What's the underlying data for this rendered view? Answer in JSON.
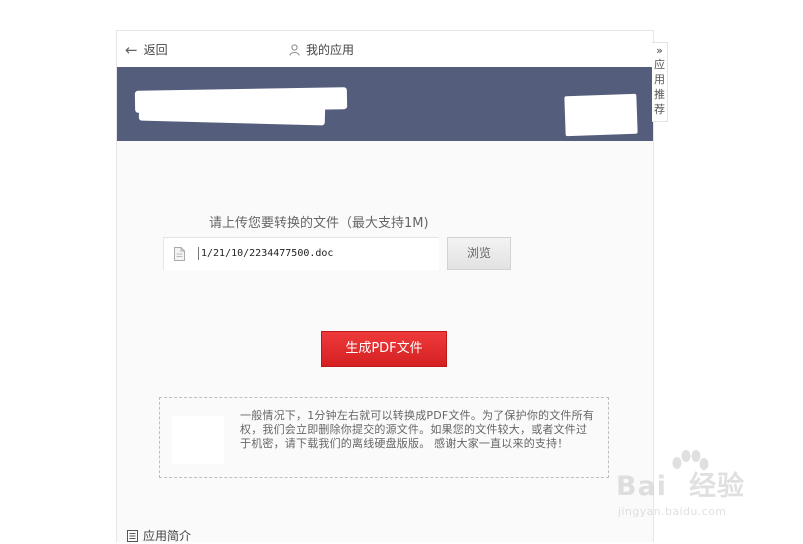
{
  "topbar": {
    "back_label": "返回",
    "my_apps_label": "我的应用"
  },
  "upload": {
    "prompt": "请上传您要转换的文件（最大支持1M)",
    "file_path": "1/21/10/2234477500.doc",
    "browse_label": "浏览"
  },
  "generate": {
    "button_label": "生成PDF文件"
  },
  "notice": {
    "text": "一般情况下，1分钟左右就可以转换成PDF文件。为了保护你的文件所有权，我们会立即删除你提交的源文件。如果您的文件较大，或者文件过于机密，请下载我们的离线硬盘版版。 感谢大家一直以来的支持！"
  },
  "footer": {
    "intro_label": "应用简介"
  },
  "side_tab": {
    "label": "应用推荐"
  },
  "watermark": {
    "brand_left": "Bai",
    "brand_right": "经验",
    "url": "jingyan.baidu.com"
  },
  "colors": {
    "banner": "#545d7c",
    "primary_button": "#e02a2a",
    "panel_bg": "#fafafa"
  },
  "icons": {
    "back": "arrow-left-icon",
    "user": "user-icon",
    "file": "document-icon",
    "intro": "list-document-icon",
    "side_tab": "double-chevron-right-icon"
  }
}
